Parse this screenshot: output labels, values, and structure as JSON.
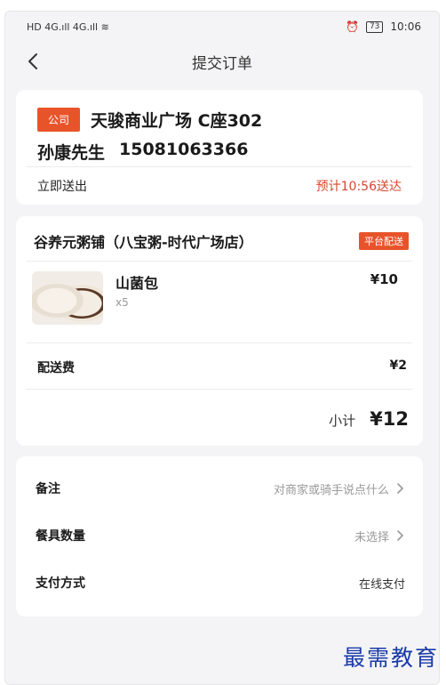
{
  "statusbar": {
    "left": "HD 4G.ıll 4G.ıll ≋",
    "alarm_icon": "alarm-icon",
    "battery": "73",
    "time": "10:06"
  },
  "navbar": {
    "title": "提交订单",
    "back_icon": "chevron-left-icon"
  },
  "address": {
    "tag": "公司",
    "address": "天骏商业广场 C座302",
    "name": "孙康先生",
    "phone": "15081063366"
  },
  "delivery": {
    "mode": "立即送出",
    "eta": "预计10:56送达"
  },
  "shop": {
    "name": "谷养元粥铺（八宝粥-时代广场店）",
    "tag": "平台配送",
    "item": {
      "name": "山菌包",
      "qty": "x5",
      "price": "¥10"
    },
    "fee_label": "配送费",
    "fee_value": "¥2",
    "subtotal_label": "小计",
    "subtotal_value": "¥12"
  },
  "options": {
    "remark_label": "备注",
    "remark_value": "对商家或骑手说点什么",
    "tableware_label": "餐具数量",
    "tableware_value": "未选择",
    "payment_label": "支付方式",
    "payment_value": "在线支付"
  },
  "watermark": "最需教育",
  "colors": {
    "accent": "#e8542a",
    "eta": "#d5482c",
    "background": "#f4f4f6",
    "watermark": "#1a3aa8"
  }
}
